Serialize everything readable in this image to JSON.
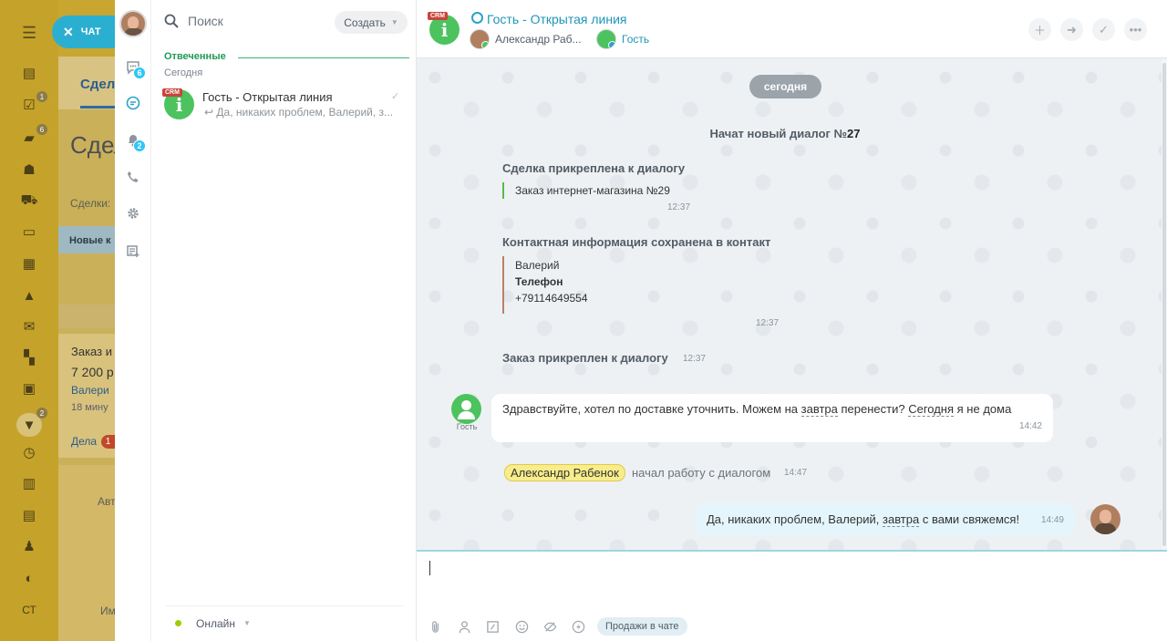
{
  "background": {
    "chat_button": "ЧАТ",
    "tab_label": "Сдел",
    "page_title": "Сдел",
    "filter_label": "Сделки:",
    "stage_label": "Новые к",
    "card_title": "Заказ и",
    "card_sum": "7 200 р",
    "card_contact": "Валери",
    "card_time": "18 мину",
    "card_tasks": "Дела",
    "card_tasks_count": "1",
    "auto_label": "Авт",
    "name_label": "Им",
    "nav_user_initials": "СТ",
    "nav_badges": [
      "1",
      "6",
      "2"
    ]
  },
  "iconbar": {
    "chats_badge": "6",
    "openlines_badge": "2"
  },
  "recent": {
    "search_placeholder": "Поиск",
    "create_label": "Создать",
    "section_title": "Отвеченные",
    "section_sub": "Сегодня",
    "items": [
      {
        "title": "Гость - Открытая линия",
        "last_message": "Да, никаких проблем, Валерий, з...",
        "badge": "CRM",
        "avatar_letter": "i"
      }
    ],
    "status": "Онлайн"
  },
  "dialog": {
    "title": "Гость - Открытая линия",
    "avatar_letter": "i",
    "crm_badge": "CRM",
    "participants": [
      {
        "name": "Александр Раб..."
      },
      {
        "name": "Гость"
      }
    ],
    "action_icons": [
      "plus-icon",
      "transfer-icon",
      "finish-icon",
      "more-icon"
    ],
    "date_pill": "сегодня",
    "started_prefix": "Начат новый диалог №",
    "started_number": "27",
    "deal_attached": {
      "title": "Сделка прикреплена к диалогу",
      "quote": "Заказ интернет-магазина №29",
      "time": "12:37"
    },
    "contact_saved": {
      "title": "Контактная информация сохранена в контакт",
      "name": "Валерий",
      "phone_label": "Телефон",
      "phone": "+79114649554",
      "time": "12:37"
    },
    "order_attached": {
      "title": "Заказ прикреплен к диалогу",
      "time": "12:37"
    },
    "guest_message": {
      "author": "Гость",
      "text_1": "Здравствуйте, хотел по доставке уточнить. Можем на ",
      "word_1": "завтра",
      "text_2": " перенести? ",
      "word_2": "Сегодня",
      "text_3": " я не дома",
      "time": "14:42"
    },
    "operator_joined": {
      "name": "Александр Рабенок",
      "text": "начал работу с диалогом",
      "time": "14:47"
    },
    "my_message": {
      "text_1": "Да, никаких проблем, Валерий, ",
      "word_1": "завтра",
      "text_2": " с вами свяжемся!",
      "time": "14:49"
    },
    "composer": {
      "value": "",
      "sales_label": "Продажи в чате"
    }
  }
}
